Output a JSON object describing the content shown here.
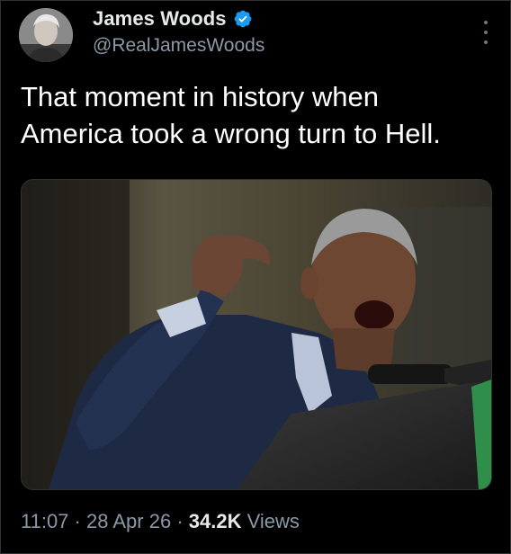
{
  "tweet": {
    "author": {
      "display_name": "James Woods",
      "handle": "@RealJamesWoods",
      "verified": true,
      "avatar_icon": "profile-photo"
    },
    "text_lines": [
      "That moment in history when",
      "America took a wrong turn to Hell."
    ],
    "media": {
      "type": "photo"
    },
    "meta": {
      "time": "11:07",
      "separator": "·",
      "date": "28 Apr 26",
      "views_count": "34.2K",
      "views_label": "Views"
    },
    "more_icon": "more-options-icon"
  },
  "colors": {
    "background": "#000000",
    "primary_text": "#e7e9ea",
    "secondary_text": "#8b98a5",
    "verified_blue": "#1d9bf0"
  }
}
